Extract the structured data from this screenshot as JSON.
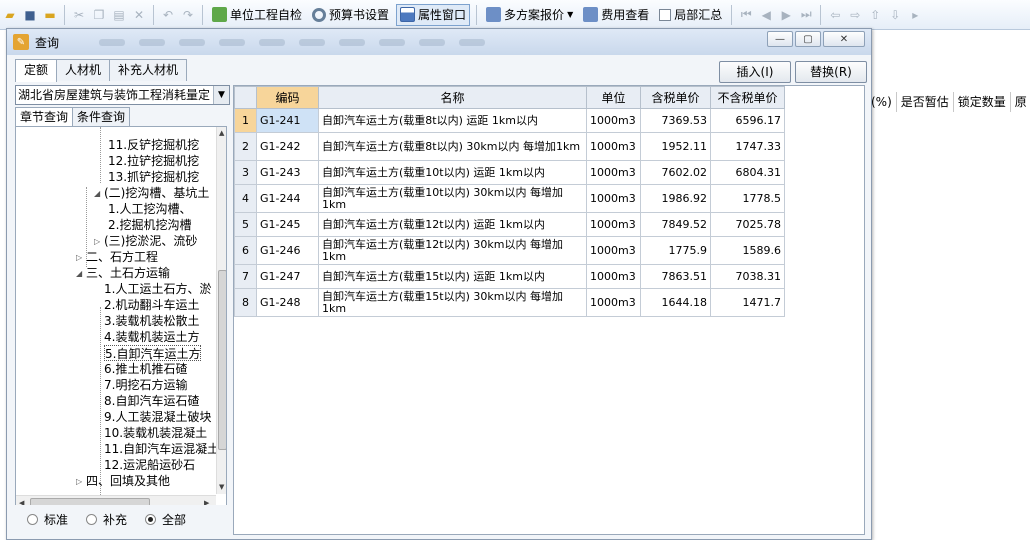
{
  "toolbar": {
    "items": [
      {
        "label": "单位工程自检"
      },
      {
        "label": "预算书设置"
      },
      {
        "label": "属性窗口"
      },
      {
        "label": "多方案报价"
      },
      {
        "label": "费用查看"
      },
      {
        "label": "局部汇总"
      }
    ]
  },
  "background_columns": [
    "(%)",
    "是否暂估",
    "锁定数量",
    "原"
  ],
  "dialog": {
    "title": "查询",
    "tabs": [
      "定额",
      "人材机",
      "补充人材机"
    ],
    "insert_button": "插入(I)",
    "replace_button": "替换(R)",
    "library_select": "湖北省房屋建筑与装饰工程消耗量定",
    "subtabs": [
      "章节查询",
      "条件查询"
    ],
    "tree": [
      "11.反铲挖掘机挖",
      "12.拉铲挖掘机挖",
      "13.抓铲挖掘机挖",
      "(二)挖沟槽、基坑土",
      "1.人工挖沟槽、",
      "2.挖掘机挖沟槽",
      "(三)挖淤泥、流砂",
      "二、石方工程",
      "三、土石方运输",
      "1.人工运土石方、淤",
      "2.机动翻斗车运土",
      "3.装载机装松散土",
      "4.装载机装运土方",
      "5.自卸汽车运土方",
      "6.推土机推石碴",
      "7.明挖石方运输",
      "8.自卸汽车运石碴",
      "9.人工装混凝土破块",
      "10.装载机装混凝土",
      "11.自卸汽车运混凝土",
      "12.运泥船运砂石",
      "四、回填及其他"
    ],
    "radios": [
      "标准",
      "补充",
      "全部"
    ],
    "radio_selected": "全部"
  },
  "table": {
    "headers": [
      "编码",
      "名称",
      "单位",
      "含税单价",
      "不含税单价"
    ],
    "rows": [
      {
        "n": "1",
        "code": "G1-241",
        "name": "自卸汽车运土方(载重8t以内) 运距 1km以内",
        "unit": "1000m3",
        "tax": "7369.53",
        "notax": "6596.17"
      },
      {
        "n": "2",
        "code": "G1-242",
        "name": "自卸汽车运土方(载重8t以内) 30km以内 每增加1km",
        "unit": "1000m3",
        "tax": "1952.11",
        "notax": "1747.33"
      },
      {
        "n": "3",
        "code": "G1-243",
        "name": "自卸汽车运土方(载重10t以内) 运距 1km以内",
        "unit": "1000m3",
        "tax": "7602.02",
        "notax": "6804.31"
      },
      {
        "n": "4",
        "code": "G1-244",
        "name": "自卸汽车运土方(载重10t以内) 30km以内 每增加1km",
        "unit": "1000m3",
        "tax": "1986.92",
        "notax": "1778.5"
      },
      {
        "n": "5",
        "code": "G1-245",
        "name": "自卸汽车运土方(载重12t以内) 运距 1km以内",
        "unit": "1000m3",
        "tax": "7849.52",
        "notax": "7025.78"
      },
      {
        "n": "6",
        "code": "G1-246",
        "name": "自卸汽车运土方(载重12t以内) 30km以内 每增加1km",
        "unit": "1000m3",
        "tax": "1775.9",
        "notax": "1589.6"
      },
      {
        "n": "7",
        "code": "G1-247",
        "name": "自卸汽车运土方(载重15t以内) 运距 1km以内",
        "unit": "1000m3",
        "tax": "7863.51",
        "notax": "7038.31"
      },
      {
        "n": "8",
        "code": "G1-248",
        "name": "自卸汽车运土方(载重15t以内) 30km以内 每增加1km",
        "unit": "1000m3",
        "tax": "1644.18",
        "notax": "1471.7"
      }
    ]
  }
}
